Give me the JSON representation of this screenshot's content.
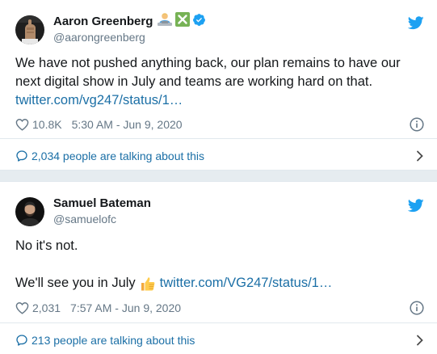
{
  "tweets": [
    {
      "author": {
        "name": "Aaron Greenberg",
        "handle": "@aarongreenberg",
        "badges": [
          "person-with-laptop-emoji",
          "cross-mark-emoji",
          "verified-icon"
        ]
      },
      "text": "We have not pushed anything back, our plan remains to have our next digital show in July and teams are working hard on that.",
      "link": "twitter.com/vg247/status/1…",
      "likes": "10.8K",
      "timestamp": "5:30 AM - Jun 9, 2020",
      "talking": "2,034 people are talking about this"
    },
    {
      "author": {
        "name": "Samuel Bateman",
        "handle": "@samuelofc",
        "badges": []
      },
      "text_line1": "No it's not.",
      "text_line2": "We'll see you in July",
      "emoji": "thumbs-up-emoji",
      "link": "twitter.com/VG247/status/1…",
      "likes": "2,031",
      "timestamp": "7:57 AM - Jun 9, 2020",
      "talking": "213 people are talking about this"
    }
  ],
  "colors": {
    "link": "#1b6fa6",
    "twitter_blue": "#1da1f2",
    "muted": "#657786",
    "separator": "#e6ecf0"
  }
}
